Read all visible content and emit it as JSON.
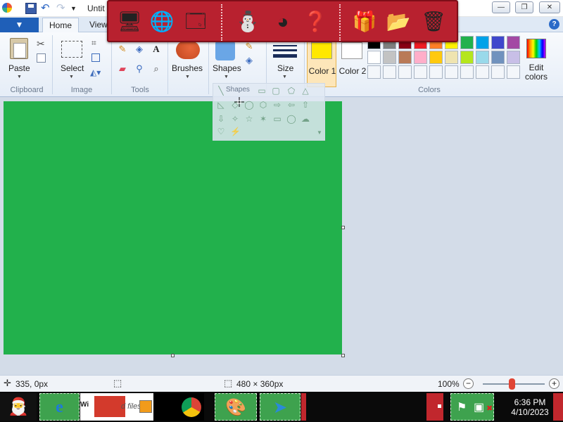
{
  "window": {
    "title": "Untit",
    "minimize_glyph": "—",
    "maximize_glyph": "❐",
    "close_glyph": "✕"
  },
  "ribbon": {
    "file_menu_glyph": "▼",
    "tabs": [
      {
        "label": "Home",
        "active": true
      },
      {
        "label": "View",
        "active": false
      }
    ],
    "help_glyph": "?",
    "groups": {
      "clipboard": {
        "label": "Clipboard",
        "paste_label": "Paste"
      },
      "image": {
        "label": "Image",
        "select_label": "Select"
      },
      "tools": {
        "label": "Tools"
      },
      "brushes": {
        "label": "Brushes"
      },
      "shapes": {
        "label": "Shapes",
        "popup_label": "Shapes"
      },
      "size": {
        "label": "Size"
      },
      "colors": {
        "label": "Colors",
        "color1_label": "Color 1",
        "color1_value": "#ffe800",
        "color2_label": "Color 2",
        "color2_value": "#ffffff",
        "edit_colors_label": "Edit colors",
        "palette_row1": [
          "#000000",
          "#7f7f7f",
          "#880015",
          "#ed1c24",
          "#ff7f27",
          "#fff200",
          "#22b14c",
          "#00a2e8",
          "#3f48cc",
          "#a349a4"
        ],
        "palette_row2": [
          "#ffffff",
          "#c3c3c3",
          "#b97a57",
          "#ffaec9",
          "#ffc90e",
          "#efe4b0",
          "#b5e61d",
          "#99d9ea",
          "#7092be",
          "#c8bfe7"
        ],
        "palette_row3": [
          "#f3f6fa",
          "#f3f6fa",
          "#f3f6fa",
          "#f3f6fa",
          "#f3f6fa",
          "#f3f6fa",
          "#f3f6fa",
          "#f3f6fa",
          "#f3f6fa",
          "#f3f6fa"
        ]
      }
    }
  },
  "canvas": {
    "fill_color": "#22b14c"
  },
  "statusbar": {
    "cursor_position": "335, 0px",
    "canvas_size": "480 × 360px",
    "zoom": "100%"
  },
  "taskbar": {
    "partial_text": "d files",
    "tray_time": "6:36 PM",
    "tray_date": "4/10/2023"
  }
}
